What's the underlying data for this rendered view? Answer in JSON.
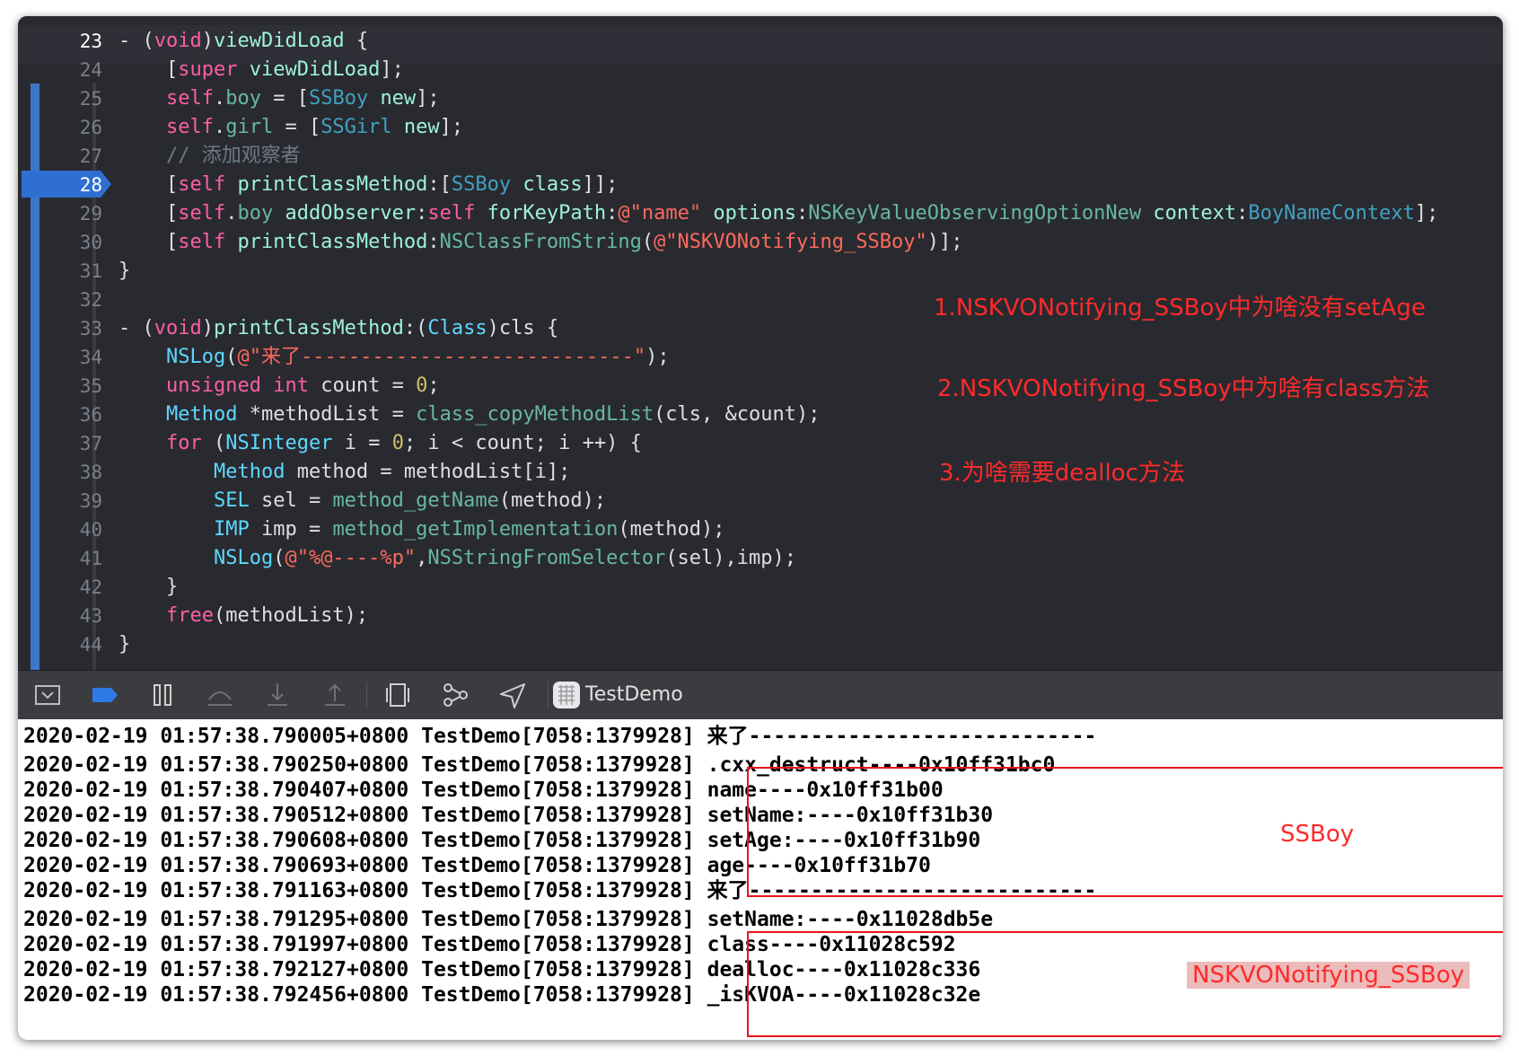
{
  "editor": {
    "current_line": "28",
    "line_numbers": [
      "23",
      "24",
      "25",
      "26",
      "27",
      "28",
      "29",
      "30",
      "31",
      "32",
      "33",
      "34",
      "35",
      "36",
      "37",
      "38",
      "39",
      "40",
      "41",
      "42",
      "43",
      "44"
    ],
    "code_lines": [
      "- (void)viewDidLoad {",
      "    [super viewDidLoad];",
      "    self.boy = [SSBoy new];",
      "    self.girl = [SSGirl new];",
      "    // 添加观察者",
      "    [self printClassMethod:[SSBoy class]];",
      "    [self.boy addObserver:self forKeyPath:@\"name\" options:NSKeyValueObservingOptionNew context:BoyNameContext];",
      "    [self printClassMethod:NSClassFromString(@\"NSKVONotifying_SSBoy\")];",
      "}",
      "",
      "- (void)printClassMethod:(Class)cls {",
      "    NSLog(@\"来了----------------------------\");",
      "    unsigned int count = 0;",
      "    Method *methodList = class_copyMethodList(cls, &count);",
      "    for (NSInteger i = 0; i < count; i ++) {",
      "        Method method = methodList[i];",
      "        SEL sel = method_getName(method);",
      "        IMP imp = method_getImplementation(method);",
      "        NSLog(@\"%@----%p\",NSStringFromSelector(sel),imp);",
      "    }",
      "    free(methodList);",
      "}"
    ]
  },
  "annotations": {
    "q1": "1.NSKVONotifying_SSBoy中为啥没有setAge",
    "q2": "2.NSKVONotifying_SSBoy中为啥有class方法",
    "q3": "3.为啥需要dealloc方法",
    "box1_label": "SSBoy",
    "box2_label": "NSKVONotifying_SSBoy",
    "color": "#ff2a2a"
  },
  "toolbar": {
    "app_name": "TestDemo",
    "icons": [
      "hide-console-icon",
      "breakpoint-icon",
      "pause-icon",
      "step-over-icon",
      "step-into-icon",
      "step-out-icon",
      "view-hierarchy-icon",
      "memory-graph-icon",
      "location-icon",
      "app-icon"
    ]
  },
  "console": {
    "prefix": "2020-02-19 01:57:38.",
    "rows": [
      {
        "prefix": "2020-02-19 01:57:38.790005+0800 TestDemo[7058:1379928]",
        "msg": "来了----------------------------"
      },
      {
        "prefix": "2020-02-19 01:57:38.790250+0800 TestDemo[7058:1379928]",
        "msg": ".cxx_destruct----0x10ff31bc0"
      },
      {
        "prefix": "2020-02-19 01:57:38.790407+0800 TestDemo[7058:1379928]",
        "msg": "name----0x10ff31b00"
      },
      {
        "prefix": "2020-02-19 01:57:38.790512+0800 TestDemo[7058:1379928]",
        "msg": "setName:----0x10ff31b30"
      },
      {
        "prefix": "2020-02-19 01:57:38.790608+0800 TestDemo[7058:1379928]",
        "msg": "setAge:----0x10ff31b90"
      },
      {
        "prefix": "2020-02-19 01:57:38.790693+0800 TestDemo[7058:1379928]",
        "msg": "age----0x10ff31b70"
      },
      {
        "prefix": "2020-02-19 01:57:38.791163+0800 TestDemo[7058:1379928]",
        "msg": "来了----------------------------"
      },
      {
        "prefix": "2020-02-19 01:57:38.791295+0800 TestDemo[7058:1379928]",
        "msg": "setName:----0x11028db5e"
      },
      {
        "prefix": "2020-02-19 01:57:38.791997+0800 TestDemo[7058:1379928]",
        "msg": "class----0x11028c592"
      },
      {
        "prefix": "2020-02-19 01:57:38.792127+0800 TestDemo[7058:1379928]",
        "msg": "dealloc----0x11028c336"
      },
      {
        "prefix": "2020-02-19 01:57:38.792456+0800 TestDemo[7058:1379928]",
        "msg": "_isKVOA----0x11028c32e"
      }
    ]
  }
}
